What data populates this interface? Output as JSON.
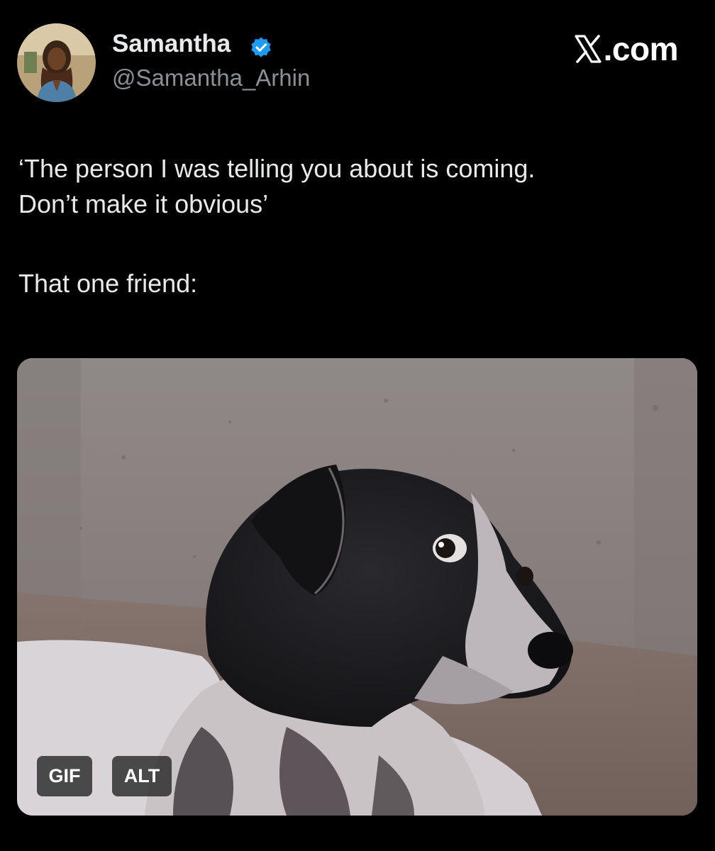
{
  "author": {
    "display_name": "Samantha",
    "handle": "@Samantha_Arhin",
    "verified_icon": "verified-badge-icon",
    "verified_color": "#1d9bf0",
    "avatar_icon": "profile-avatar"
  },
  "site": {
    "logo_icon": "x-logo-icon",
    "label": ".com"
  },
  "tweet": {
    "lines": [
      "‘The person I was telling you about is coming.",
      "Don’t make it obvious’",
      "That one friend:"
    ]
  },
  "media": {
    "type": "gif",
    "subject": "dog-side-eye-image",
    "badges": {
      "gif": "GIF",
      "alt": "ALT"
    }
  },
  "colors": {
    "background": "#000000",
    "text": "#e7e9ea",
    "secondary_text": "#8b9095"
  }
}
